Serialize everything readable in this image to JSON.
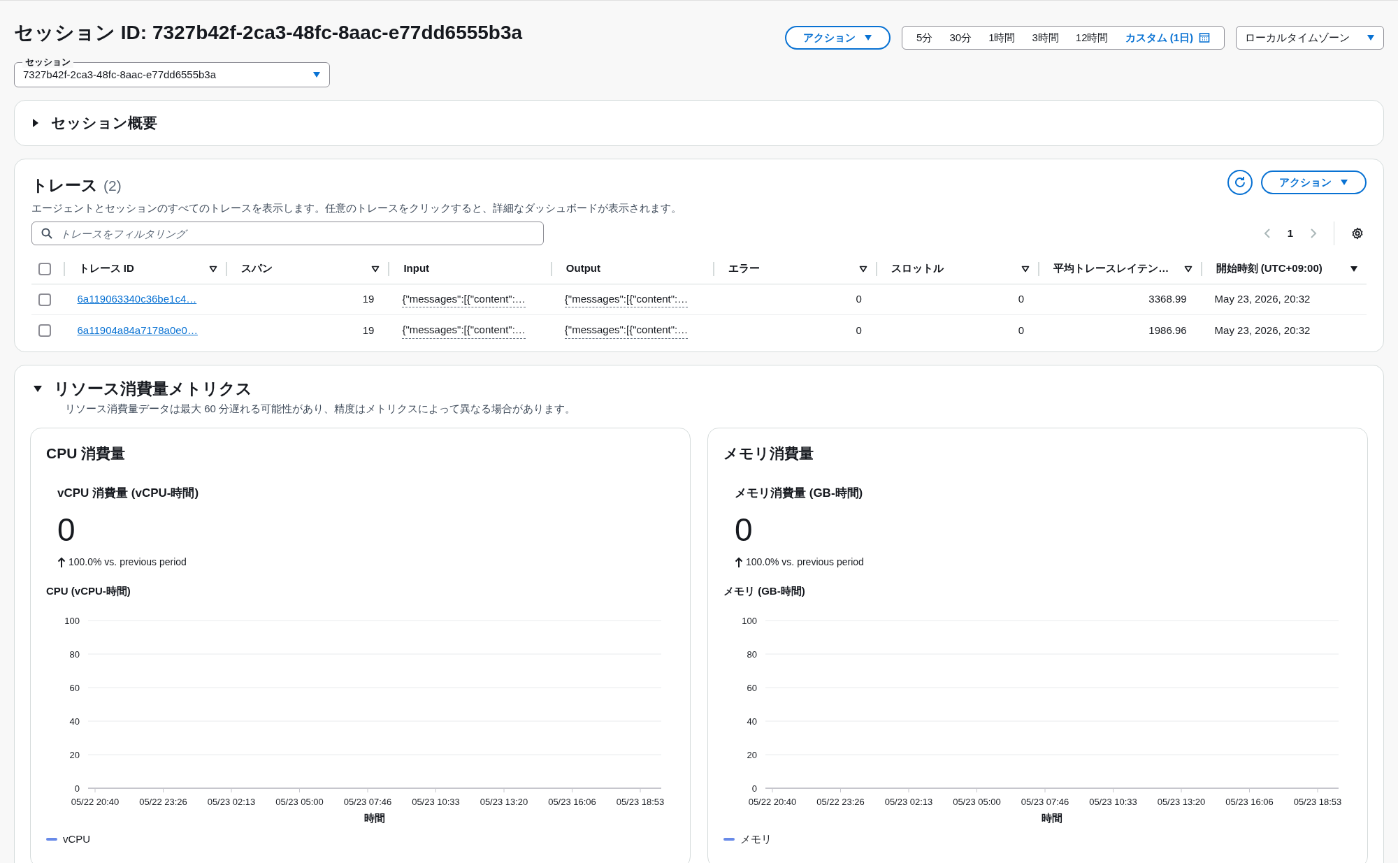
{
  "header": {
    "title": "セッション ID: 7327b42f-2ca3-48fc-8aac-e77dd6555b3a",
    "actions_button": "アクション",
    "time_range": [
      {
        "label": "5分",
        "selected": false
      },
      {
        "label": "30分",
        "selected": false
      },
      {
        "label": "1時間",
        "selected": false
      },
      {
        "label": "3時間",
        "selected": false
      },
      {
        "label": "12時間",
        "selected": false
      },
      {
        "label": "カスタム (1日)",
        "selected": true
      }
    ],
    "timezone": "ローカルタイムゾーン",
    "session_select": {
      "label": "セッション",
      "value": "7327b42f-2ca3-48fc-8aac-e77dd6555b3a"
    }
  },
  "session_summary": {
    "title": "セッション概要",
    "expanded": false
  },
  "traces": {
    "title": "トレース",
    "count": "(2)",
    "description": "エージェントとセッションのすべてのトレースを表示します。任意のトレースをクリックすると、詳細なダッシュボードが表示されます。",
    "actions_button": "アクション",
    "filter": {
      "placeholder": "トレースをフィルタリング"
    },
    "page": "1",
    "select_all": {
      "checked": false
    },
    "columns": [
      {
        "label": "トレース ID",
        "sortable": true,
        "sorted": false
      },
      {
        "label": "スパン",
        "sortable": true,
        "sorted": false
      },
      {
        "label": "Input",
        "sortable": false
      },
      {
        "label": "Output",
        "sortable": false
      },
      {
        "label": "エラー",
        "sortable": true,
        "sorted": false
      },
      {
        "label": "スロットル",
        "sortable": true,
        "sorted": false
      },
      {
        "label": "平均トレースレイテン…",
        "sortable": true,
        "sorted": false
      },
      {
        "label": "開始時刻 (UTC+09:00)",
        "sorted": true
      }
    ],
    "rows": [
      {
        "checked": false,
        "cells": [
          "6a119063340c36be1c4…",
          "19",
          "{\"messages\":[{\"content\":…",
          "{\"messages\":[{\"content\":…",
          "0",
          "0",
          "3368.99",
          "May 23, 2026, 20:32"
        ]
      },
      {
        "checked": false,
        "cells": [
          "6a11904a84a7178a0e0…",
          "19",
          "{\"messages\":[{\"content\":…",
          "{\"messages\":[{\"content\":…",
          "0",
          "0",
          "1986.96",
          "May 23, 2026, 20:32"
        ]
      }
    ]
  },
  "metrics": {
    "title": "リソース消費量メトリクス",
    "expanded": true,
    "description": "リソース消費量データは最大 60 分遅れる可能性があり、精度はメトリクスによって異なる場合があります。",
    "cards": [
      {
        "title": "CPU 消費量",
        "kpi_label": "vCPU 消費量 (vCPU-時間)",
        "kpi_value": "0",
        "change": "100.0% vs. previous period",
        "chart_data": {
          "type": "line",
          "grid": true,
          "title": "CPU (vCPU-時間)",
          "xlabel": "時間",
          "categories": [
            "05/22 20:40",
            "05/22 23:26",
            "05/23 02:13",
            "05/23 05:00",
            "05/23 07:46",
            "05/23 10:33",
            "05/23 13:20",
            "05/23 16:06",
            "05/23 18:53"
          ],
          "ylim": [
            0,
            100
          ],
          "yticks": [
            0,
            20,
            40,
            60,
            80,
            100
          ],
          "series": [
            {
              "name": "vCPU",
              "color": "#688ae8",
              "values": [
                null,
                null,
                null,
                null,
                null,
                null,
                null,
                null,
                null
              ]
            }
          ]
        }
      },
      {
        "title": "メモリ消費量",
        "kpi_label": "メモリ消費量 (GB-時間)",
        "kpi_value": "0",
        "change": "100.0% vs. previous period",
        "chart_data": {
          "type": "line",
          "grid": true,
          "title": "メモリ (GB-時間)",
          "xlabel": "時間",
          "categories": [
            "05/22 20:40",
            "05/22 23:26",
            "05/23 02:13",
            "05/23 05:00",
            "05/23 07:46",
            "05/23 10:33",
            "05/23 13:20",
            "05/23 16:06",
            "05/23 18:53"
          ],
          "ylim": [
            0,
            100
          ],
          "yticks": [
            0,
            20,
            40,
            60,
            80,
            100
          ],
          "series": [
            {
              "name": "メモリ",
              "color": "#688ae8",
              "values": [
                null,
                null,
                null,
                null,
                null,
                null,
                null,
                null,
                null
              ]
            }
          ]
        }
      }
    ]
  }
}
